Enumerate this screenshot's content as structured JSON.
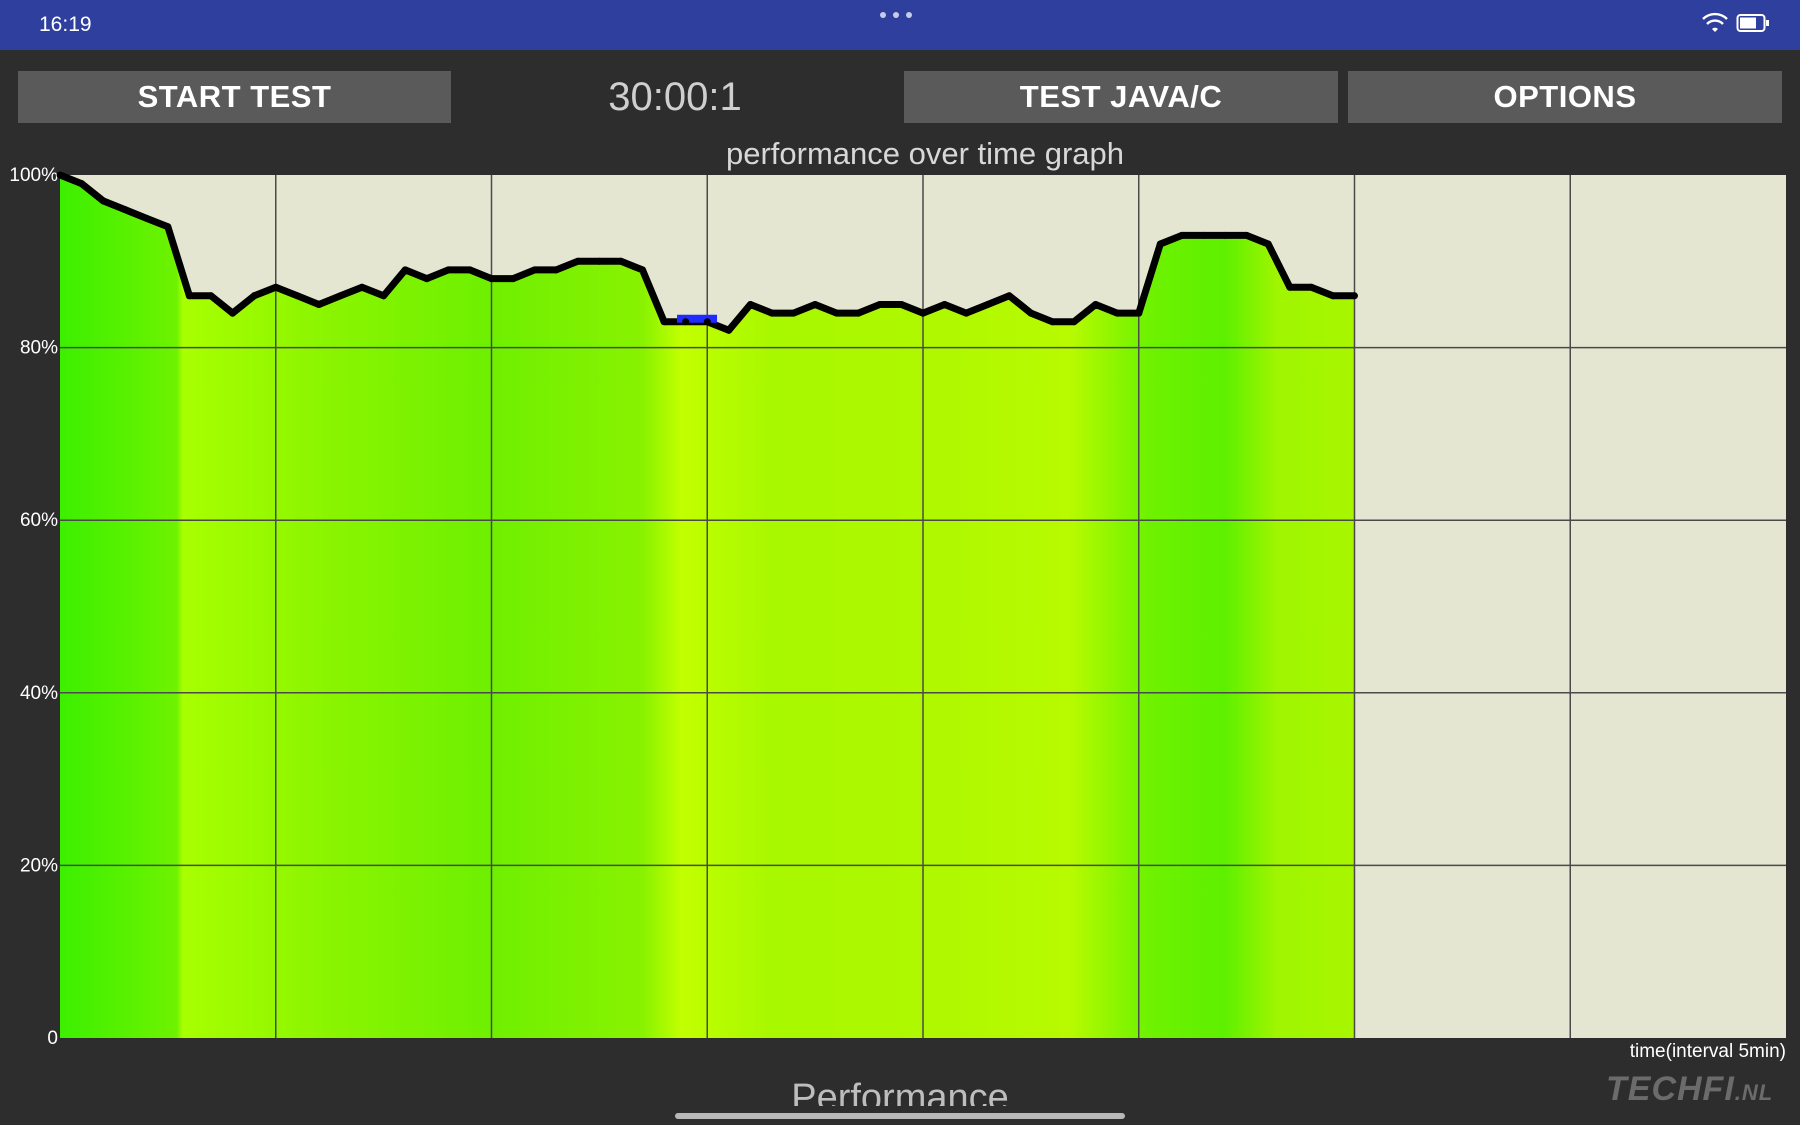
{
  "status_bar": {
    "time": "16:19"
  },
  "toolbar": {
    "start_label": "START TEST",
    "timer": "30:00:1",
    "test_label": "TEST JAVA/C",
    "options_label": "OPTIONS"
  },
  "chart_data": {
    "type": "line",
    "title": "performance over time graph",
    "xlabel": "time(interval 5min)",
    "ylabel": "",
    "y_ticks": [
      "0",
      "20%",
      "40%",
      "60%",
      "80%",
      "100%"
    ],
    "ylim": [
      0,
      100
    ],
    "xlim": [
      0,
      40
    ],
    "grid": true,
    "x": [
      0,
      0.5,
      1,
      1.5,
      2,
      2.5,
      3,
      3.5,
      4,
      4.5,
      5,
      5.5,
      6,
      6.5,
      7,
      7.5,
      8,
      8.5,
      9,
      9.5,
      10,
      10.5,
      11,
      11.5,
      12,
      12.5,
      13,
      13.5,
      14,
      14.5,
      15,
      15.5,
      16,
      16.5,
      17,
      17.5,
      18,
      18.5,
      19,
      19.5,
      20,
      20.5,
      21,
      21.5,
      22,
      22.5,
      23,
      23.5,
      24,
      24.5,
      25,
      25.5,
      26,
      26.5,
      27,
      27.5,
      28,
      28.5,
      29,
      29.5,
      30
    ],
    "values": [
      100,
      99,
      97,
      96,
      95,
      94,
      86,
      86,
      84,
      86,
      87,
      86,
      85,
      86,
      87,
      86,
      89,
      88,
      89,
      89,
      88,
      88,
      89,
      89,
      90,
      90,
      90,
      89,
      83,
      83,
      83,
      82,
      85,
      84,
      84,
      85,
      84,
      84,
      85,
      85,
      84,
      85,
      84,
      85,
      86,
      84,
      83,
      83,
      85,
      84,
      84,
      92,
      93,
      93,
      93,
      93,
      92,
      87,
      87,
      86,
      86
    ],
    "colors": {
      "plot_background": "#e4e6d2",
      "fill_green": "#8cf000",
      "line": "#000000",
      "grid": "#4a4a4a",
      "marker": "#1f2bff"
    }
  },
  "watermark": {
    "main": "TECHFI",
    "suffix": ".NL"
  },
  "bottom_label": "Performance"
}
